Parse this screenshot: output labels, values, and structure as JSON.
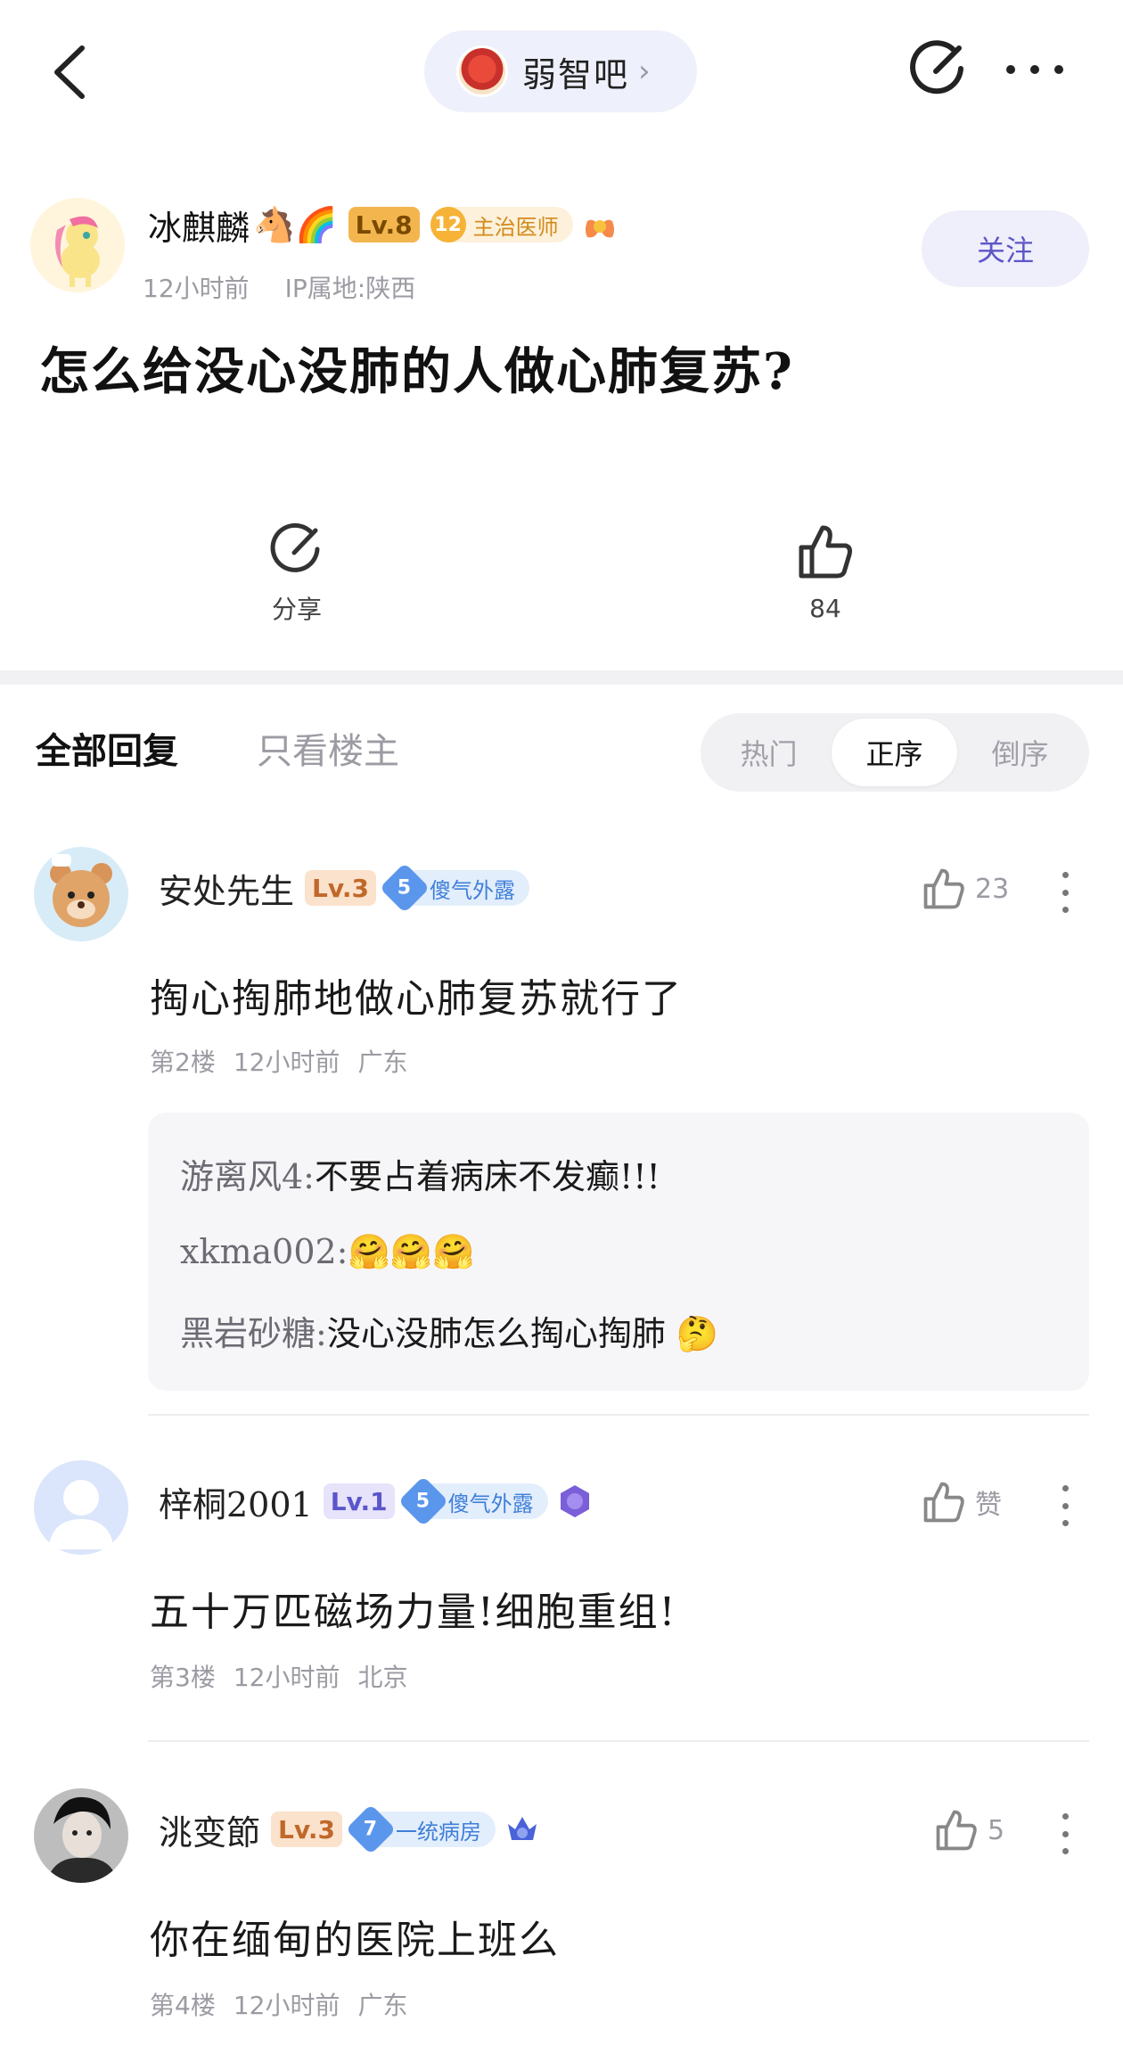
{
  "nav": {
    "forum_name": "弱智吧",
    "chevron": "›"
  },
  "post": {
    "author": "冰麒麟",
    "author_emojis": "🐴🌈",
    "level": "Lv.8",
    "title_badge_num": "12",
    "title_badge_text": "主治医师",
    "time": "12小时前",
    "ip": "IP属地:陕西",
    "follow_label": "关注",
    "title": "怎么给没心没肺的人做心肺复苏?",
    "share_label": "分享",
    "like_count": "84"
  },
  "tabs": {
    "all": "全部回复",
    "owner_only": "只看楼主"
  },
  "sort": {
    "hot": "热门",
    "asc": "正序",
    "desc": "倒序",
    "active": "asc"
  },
  "replies": [
    {
      "name": "安处先生",
      "level": "Lv.3",
      "badge_num": "5",
      "badge_text": "傻气外露",
      "like": "23",
      "content": "掏心掏肺地做心肺复苏就行了",
      "floor": "第2楼",
      "time": "12小时前",
      "location": "广东",
      "sub_replies": [
        {
          "author": "游离风4:",
          "text": "不要占着病床不发癫!!!"
        },
        {
          "author": "xkma002:",
          "text": "🤗🤗🤗"
        },
        {
          "author": "黑岩砂糖:",
          "text": "没心没肺怎么掏心掏肺 🤔"
        }
      ]
    },
    {
      "name": "梓桐2001",
      "level": "Lv.1",
      "badge_num": "5",
      "badge_text": "傻气外露",
      "like": "赞",
      "content": "五十万匹磁场力量!细胞重组!",
      "floor": "第3楼",
      "time": "12小时前",
      "location": "北京"
    },
    {
      "name": "洮变節",
      "level": "Lv.3",
      "badge_num": "7",
      "badge_text": "一统病房",
      "like": "5",
      "content": "你在缅甸的医院上班么",
      "floor": "第4楼",
      "time": "12小时前",
      "location": "广东"
    }
  ],
  "colors": {
    "accent": "#5c56c6",
    "muted": "#9b9ba3",
    "pill_bg": "#eef0fb"
  }
}
